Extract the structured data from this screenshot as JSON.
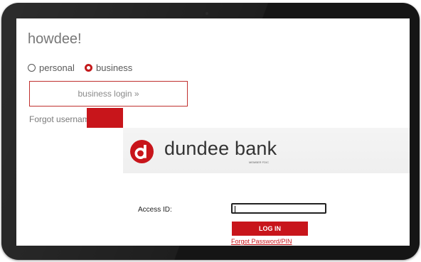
{
  "page": {
    "greeting": "howdee!",
    "account_type": {
      "options": [
        {
          "label": "personal",
          "selected": false
        },
        {
          "label": "business",
          "selected": true
        }
      ]
    },
    "business_login_label": "business login »",
    "forgot_link": "Forgot username or password »"
  },
  "login_panel": {
    "logo_letter": "d",
    "brand_name": "dundee bank",
    "member_fdic": "MEMBER FDIC",
    "access_id_label": "Access ID:",
    "access_id_value": "",
    "login_button": "LOG IN",
    "forgot_link": "Forgot Password/PIN"
  },
  "colors": {
    "brand_red": "#c8151b",
    "bezel": "#151515",
    "muted_text": "#777777"
  },
  "icons": {
    "logo": "dundee-d-logo-icon",
    "radio_unselected": "radio-unchecked-icon",
    "radio_selected": "radio-checked-icon"
  }
}
